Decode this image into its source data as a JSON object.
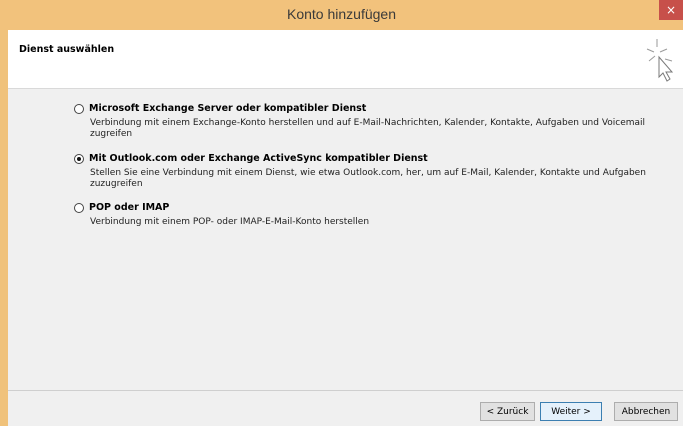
{
  "window": {
    "title": "Konto hinzufügen",
    "close_glyph": "×"
  },
  "header": {
    "title": "Dienst auswählen",
    "icon": "wizard-cursor-icon"
  },
  "options": [
    {
      "label": "Microsoft Exchange Server oder kompatibler Dienst",
      "description": "Verbindung mit einem Exchange-Konto herstellen und auf E-Mail-Nachrichten, Kalender, Kontakte, Aufgaben und Voicemail zugreifen",
      "selected": false
    },
    {
      "label": "Mit Outlook.com oder Exchange ActiveSync kompatibler Dienst",
      "description": "Stellen Sie eine Verbindung mit einem Dienst, wie etwa Outlook.com, her, um auf E-Mail, Kalender, Kontakte und Aufgaben zuzugreifen",
      "selected": true
    },
    {
      "label": "POP oder IMAP",
      "description": "Verbindung mit einem POP- oder IMAP-E-Mail-Konto herstellen",
      "selected": false
    }
  ],
  "buttons": {
    "back": "< Zurück",
    "next": "Weiter >",
    "cancel": "Abbrechen"
  },
  "colors": {
    "titlebar": "#f2c27c",
    "close": "#c7504a",
    "default_button_border": "#3c7fb1"
  }
}
